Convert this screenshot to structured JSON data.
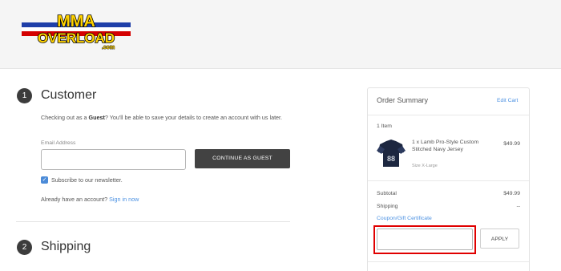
{
  "brand": {
    "logo_text": "MMA OVERLOAD .com"
  },
  "customer": {
    "step_number": "1",
    "title": "Customer",
    "intro_prefix": "Checking out as a ",
    "intro_bold": "Guest",
    "intro_suffix": "? You'll be able to save your details to create an account with us later.",
    "email_label": "Email Address",
    "email_value": "",
    "continue_button": "CONTINUE AS GUEST",
    "newsletter_label": "Subscribe to our newsletter.",
    "newsletter_checked": true,
    "signin_prefix": "Already have an account?",
    "signin_link": "Sign in now"
  },
  "shipping": {
    "step_number": "2",
    "title": "Shipping"
  },
  "order_summary": {
    "title": "Order Summary",
    "edit_cart": "Edit Cart",
    "item_count": "1 Item",
    "items": [
      {
        "name": "1 x Lamb Pro-Style Custom Stitched Navy Jersey",
        "size": "Size X-Large",
        "price": "$49.99"
      }
    ],
    "subtotal_label": "Subtotal",
    "subtotal_value": "$49.99",
    "shipping_label": "Shipping",
    "shipping_value": "--",
    "coupon_link": "Coupon/Gift Certificate",
    "coupon_value": "",
    "apply_button": "APPLY"
  },
  "colors": {
    "accent_link": "#4a90e2",
    "button_dark": "#424242",
    "highlight": "#e00000"
  }
}
